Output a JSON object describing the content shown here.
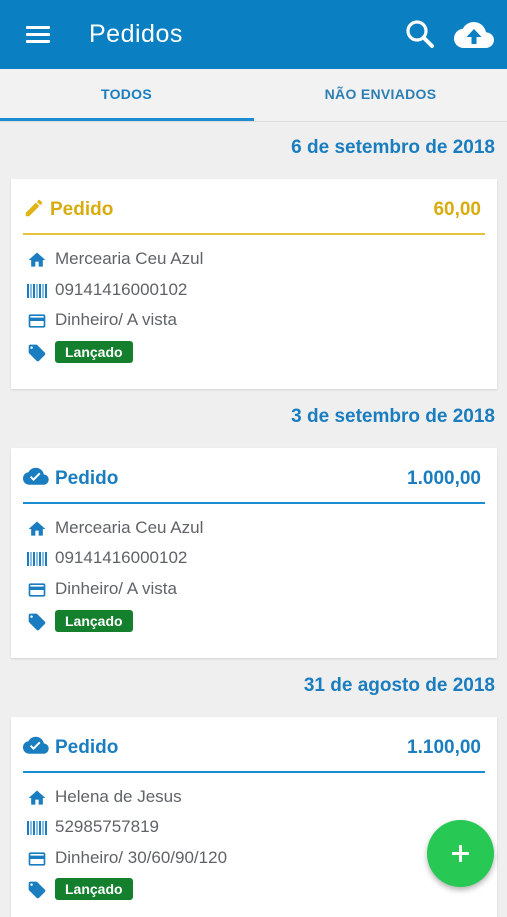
{
  "appbar": {
    "title": "Pedidos",
    "icons": [
      "menu-icon",
      "search-icon",
      "cloud-upload-icon"
    ]
  },
  "tabs": [
    {
      "label": "TODOS",
      "selected": true
    },
    {
      "label": "NÃO ENVIADOS",
      "selected": false
    }
  ],
  "colors": {
    "primary": "#0a7fc2",
    "draft": "#e0b416",
    "sent": "#1a7dbf",
    "badge": "#14802d",
    "fab": "#28c855"
  },
  "orders": [
    {
      "date": "6 de setembro de 2018",
      "status_icon": "pencil-icon",
      "label": "Pedido",
      "value": "60,00",
      "customer": "Mercearia Ceu Azul",
      "document": "09141416000102",
      "payment": "Dinheiro/ A vista",
      "badge": "Lançado"
    },
    {
      "date": "3 de setembro de 2018",
      "status_icon": "cloud-check-icon",
      "label": "Pedido",
      "value": "1.000,00",
      "customer": "Mercearia Ceu Azul",
      "document": "09141416000102",
      "payment": "Dinheiro/ A vista",
      "badge": "Lançado"
    },
    {
      "date": "31 de agosto de 2018",
      "status_icon": "cloud-check-icon",
      "label": "Pedido",
      "value": "1.100,00",
      "customer": "Helena de Jesus",
      "document": "52985757819",
      "payment": "Dinheiro/ 30/60/90/120",
      "badge": "Lançado"
    }
  ],
  "fab": {
    "icon": "plus-icon"
  }
}
